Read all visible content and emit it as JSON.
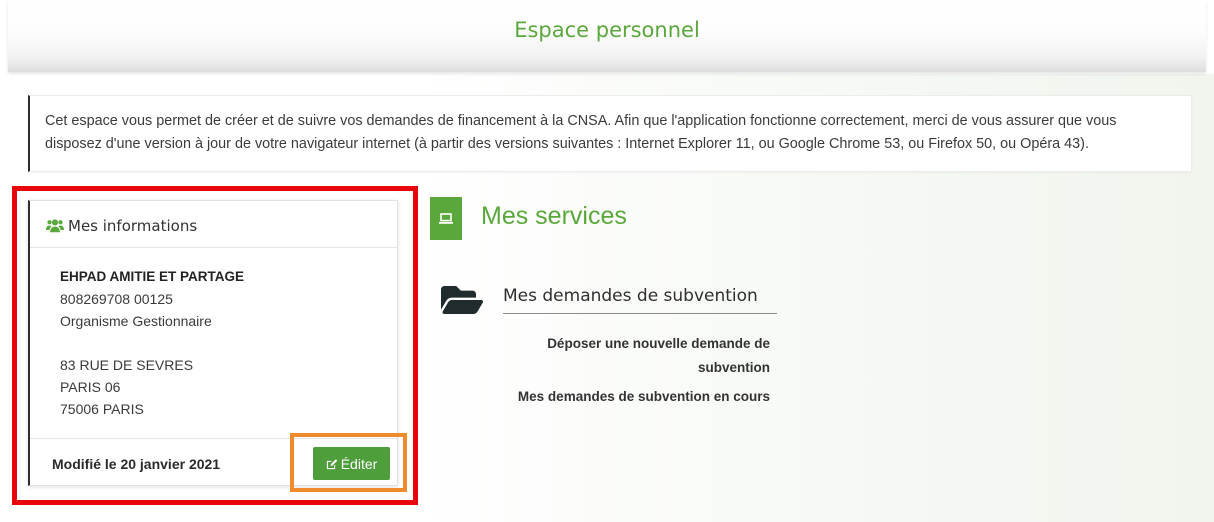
{
  "header": {
    "title": "Espace personnel"
  },
  "intro": {
    "lines": [
      "Cet espace vous permet de créer et de suivre vos demandes de financement à la CNSA. Afin que l'application fonctionne correctement, merci de vous assurer que vous",
      "disposez d'une version à jour de votre navigateur internet (à partir des versions suivantes : Internet Explorer 11, ou Google Chrome 53, ou Firefox 50, ou Opéra 43)."
    ]
  },
  "info_card": {
    "icon": "users-icon",
    "title": "Mes informations",
    "org_name": "EHPAD AMITIE ET PARTAGE",
    "siret": "808269708 00125",
    "org_type": "Organisme Gestionnaire",
    "address_lines": [
      "83 RUE DE SEVRES",
      "PARIS 06",
      "75006 PARIS"
    ],
    "modified_label": "Modifié le 20 janvier 2021",
    "edit_button": {
      "icon": "edit-icon",
      "label": "Éditer"
    }
  },
  "services": {
    "icon": "laptop-icon",
    "title": "Mes services",
    "groups": [
      {
        "icon": "folder-open-icon",
        "title": "Mes demandes de subvention",
        "links": [
          "Déposer une nouvelle demande de subvention",
          "Mes demandes de subvention en cours"
        ]
      }
    ]
  },
  "annotations": {
    "card_highlight_color": "#e8060c",
    "button_highlight_color": "#ee8b2d"
  },
  "theme": {
    "accent": "#5aa83b",
    "button_green": "#4e9f3c",
    "folder_color": "#1f2b2c",
    "text": "#333333"
  }
}
